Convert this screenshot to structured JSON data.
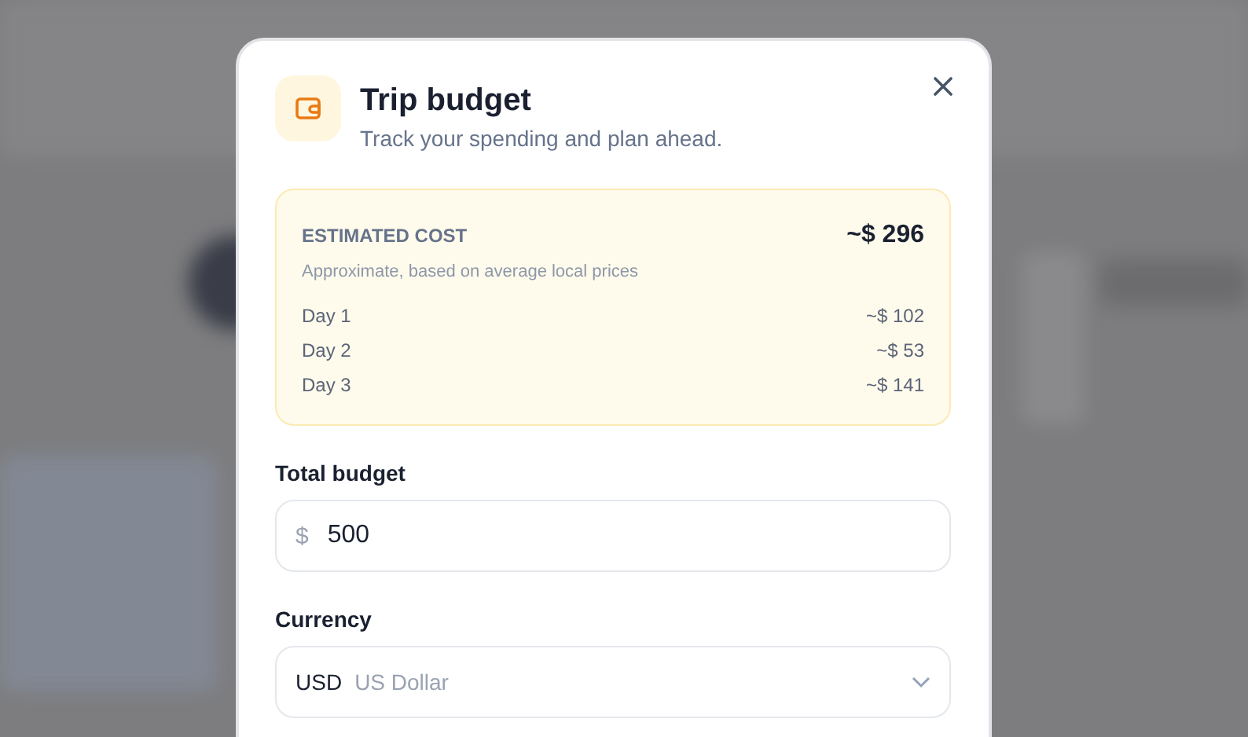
{
  "dialog": {
    "title": "Trip budget",
    "subtitle": "Track your spending and plan ahead.",
    "estimate": {
      "label": "ESTIMATED COST",
      "total": "~$ 296",
      "note": "Approximate, based on average local prices",
      "days": [
        {
          "label": "Day 1",
          "amount": "~$ 102"
        },
        {
          "label": "Day 2",
          "amount": "~$ 53"
        },
        {
          "label": "Day 3",
          "amount": "~$ 141"
        }
      ]
    },
    "budget": {
      "label": "Total budget",
      "prefix": "$",
      "value": "500"
    },
    "currency": {
      "label": "Currency",
      "code": "USD",
      "name": "US Dollar"
    }
  }
}
